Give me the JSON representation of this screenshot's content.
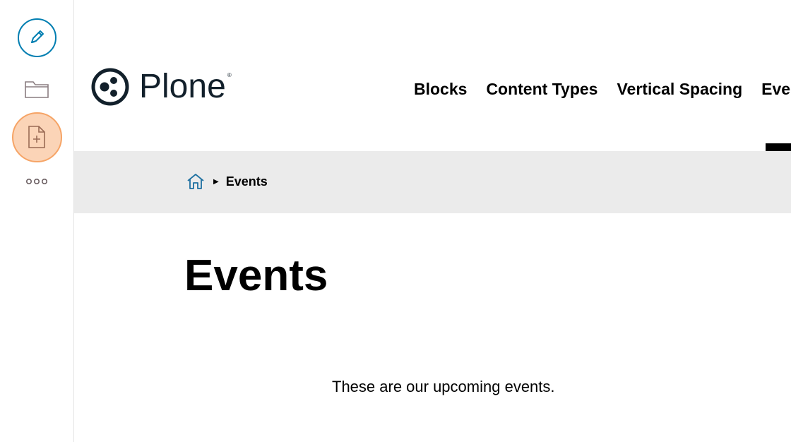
{
  "toolbar": {
    "edit_icon": "pencil-icon",
    "folder_icon": "folder-icon",
    "add_icon": "add-document-icon",
    "more_icon": "more-dots-icon",
    "accent_color": "#007eb1",
    "highlight_color": "#fbd4b7"
  },
  "header": {
    "logo_text": "Plone",
    "logo_mark": "®",
    "nav": [
      "Blocks",
      "Content Types",
      "Vertical Spacing",
      "Eve"
    ]
  },
  "breadcrumb": {
    "home_icon": "home-icon",
    "current": "Events"
  },
  "main": {
    "title": "Events",
    "description": "These are our upcoming events."
  }
}
